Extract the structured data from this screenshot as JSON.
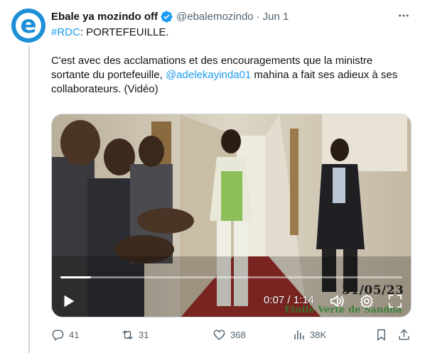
{
  "author": {
    "name": "Ebale ya mozindo off",
    "handle": "@ebalemozindo",
    "separator": "·",
    "date": "Jun 1",
    "avatar_letter": "e",
    "verified_color": "#1d9bf0"
  },
  "tweet": {
    "hashtag": "#RDC",
    "line1_rest": ": PORTEFEUILLE.",
    "body_part1": "C'est avec des acclamations et des encouragements que la ministre sortante du portefeuille, ",
    "mention": "@adelekayinda01",
    "body_part2": " mahina a fait ses adieux à ses collaborateurs. (Vidéo)"
  },
  "video": {
    "timecode": "0:07 / 1:14",
    "progress_fraction": 0.09,
    "stamp_date": "31/05/23",
    "watermark": "Etoile Verte de Sandoa"
  },
  "actions": {
    "replies": "41",
    "reposts": "31",
    "likes": "368",
    "views": "38K"
  },
  "icons": {
    "more": "more-icon",
    "verified": "verified-badge-icon",
    "reply": "reply-icon",
    "repost": "repost-icon",
    "like": "heart-icon",
    "views": "analytics-icon",
    "bookmark": "bookmark-icon",
    "share": "share-icon",
    "play": "play-icon",
    "volume": "volume-icon",
    "settings": "gear-icon",
    "fullscreen": "fullscreen-icon"
  },
  "colors": {
    "accent": "#1d9bf0",
    "secondary_text": "#536471",
    "primary_text": "#0f1419"
  }
}
